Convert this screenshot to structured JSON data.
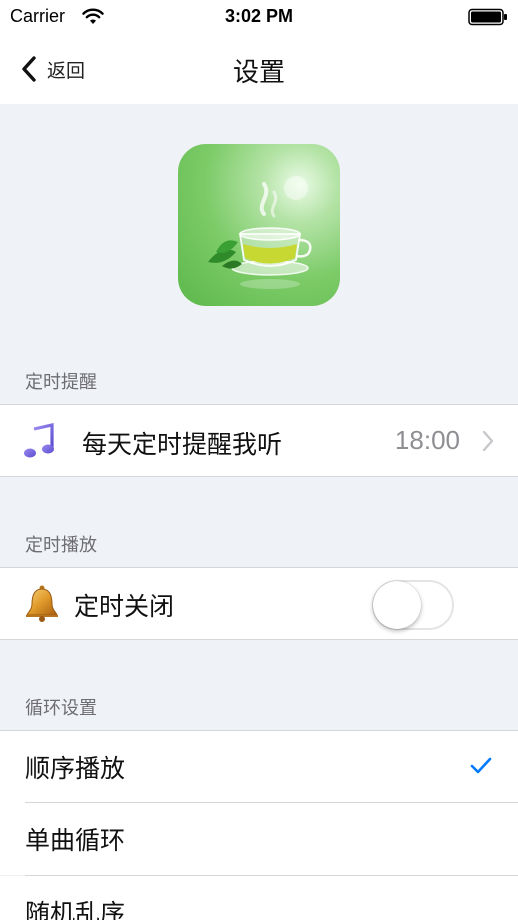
{
  "status_bar": {
    "carrier": "Carrier",
    "time": "3:02 PM",
    "wifi_icon": "wifi-icon",
    "battery_icon": "battery-icon"
  },
  "nav": {
    "back_label": "返回",
    "back_icon": "chevron-left-icon",
    "title": "设置"
  },
  "app_icon": {
    "icon": "green-tea-cup-icon"
  },
  "sections": {
    "reminder": {
      "header": "定时提醒",
      "row_label": "每天定时提醒我听",
      "row_value": "18:00",
      "icon": "music-note-icon"
    },
    "timer": {
      "header": "定时播放",
      "row_label": "定时关闭",
      "icon": "bell-icon",
      "toggle_on": false
    },
    "loop": {
      "header": "循环设置",
      "options": [
        {
          "label": "顺序播放",
          "selected": true
        },
        {
          "label": "单曲循环",
          "selected": false
        },
        {
          "label": "随机乱序",
          "selected": false
        }
      ]
    }
  },
  "colors": {
    "background": "#eff2f6",
    "accent": "#007aff",
    "secondary_text": "#6d6d72",
    "value_text": "#8e8e93"
  }
}
